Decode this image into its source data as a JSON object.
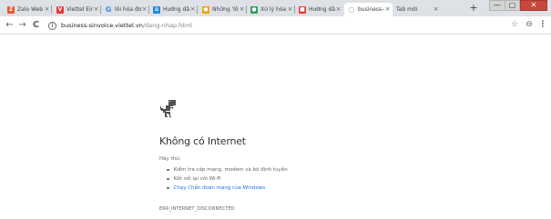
{
  "window": {
    "minimize_glyph": "—",
    "maximize_glyph": "▢",
    "close_glyph": "✕"
  },
  "tabs": [
    {
      "label": "Zalo Web",
      "icon": "zalo-icon",
      "icon_color": "#e8542f",
      "icon_glyph": "Z",
      "active": false
    },
    {
      "label": "Viettel Einvo",
      "icon": "viettel-icon",
      "icon_color": "#e53935",
      "icon_glyph": "V",
      "active": false
    },
    {
      "label": "lỗi hóa đơn",
      "icon": "google-icon",
      "icon_color": "#4285f4",
      "icon_glyph": "G",
      "active": false
    },
    {
      "label": "Hướng dẫn",
      "icon": "page-icon",
      "icon_color": "#1e88e5",
      "icon_glyph": "≡",
      "active": false
    },
    {
      "label": "Những 'lỗi'",
      "icon": "bulb-icon",
      "icon_color": "#f4a100",
      "icon_glyph": "●",
      "active": false
    },
    {
      "label": "Xử lý hóa đơ",
      "icon": "globe-icon",
      "icon_color": "#2e9d5a",
      "icon_glyph": "●",
      "active": false
    },
    {
      "label": "Hướng dẫn",
      "icon": "doc-icon",
      "icon_color": "#e53935",
      "icon_glyph": "■",
      "active": false
    },
    {
      "label": "business-sin",
      "icon": "offline-globe-icon",
      "icon_color": "#5f6368",
      "icon_glyph": "◌",
      "active": true
    },
    {
      "label": "Tab mới",
      "icon": "",
      "icon_color": "#ffffff",
      "icon_glyph": "",
      "active": false
    }
  ],
  "tab_close_glyph": "×",
  "new_tab_glyph": "+",
  "toolbar": {
    "back_glyph": "←",
    "forward_glyph": "→",
    "reload_glyph": "C",
    "url_host": "business-sinvoice.viettel.vn",
    "url_path": "/dang-nhap.html",
    "info_glyph": "i",
    "star_glyph": "☆",
    "account_glyph": "⊖",
    "menu_glyph": "⋮"
  },
  "error_page": {
    "title": "Không có Internet",
    "try_label": "Hãy thử:",
    "suggestions": [
      {
        "text": "Kiểm tra cáp mạng, modem và bộ định tuyến",
        "link": false
      },
      {
        "text": "Kết nối lại với Wi-Fi",
        "link": false
      },
      {
        "text": "Chạy Chẩn đoán mạng của Windows",
        "link": true
      }
    ],
    "error_code": "ERR_INTERNET_DISCONNECTED"
  }
}
